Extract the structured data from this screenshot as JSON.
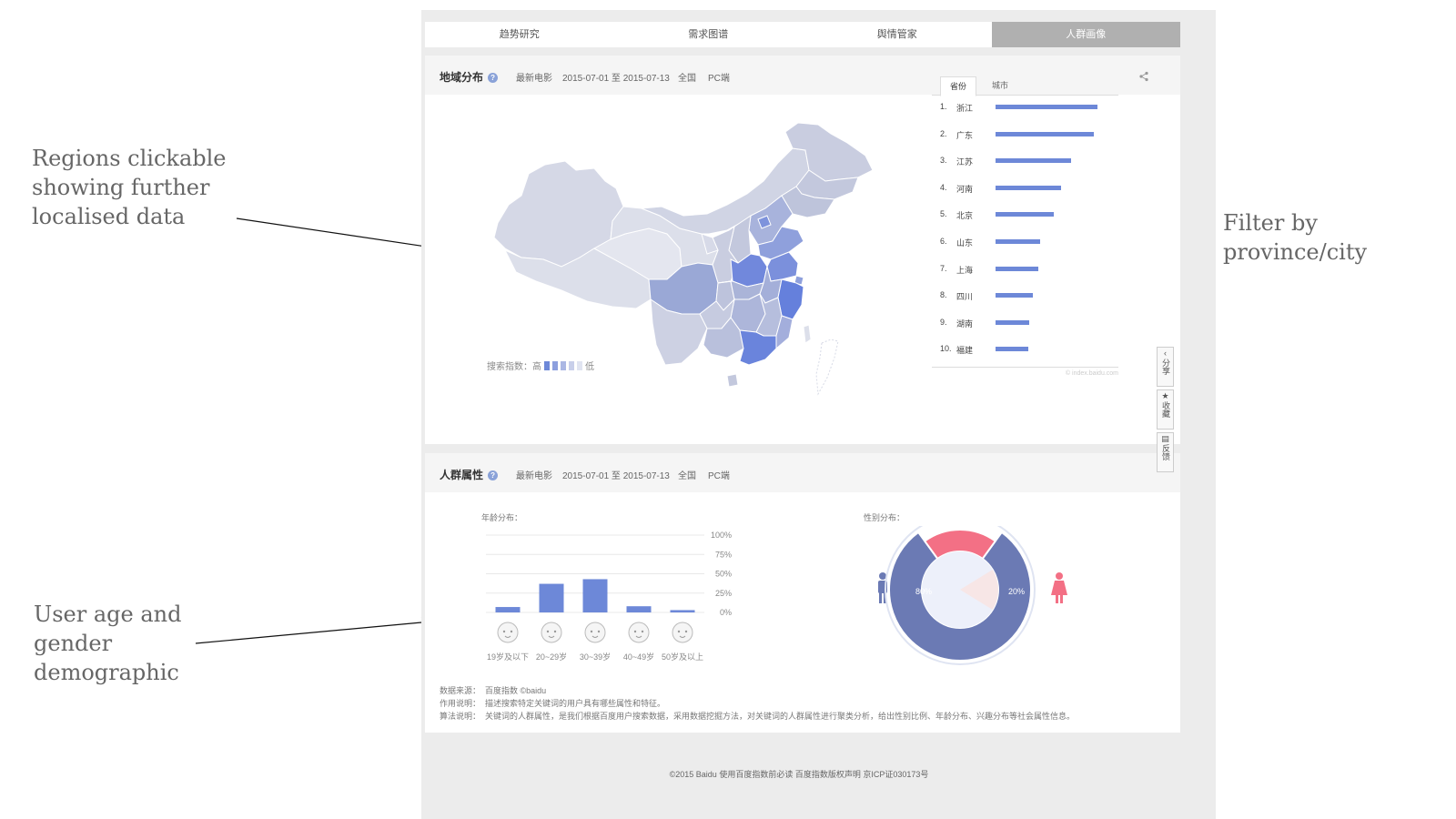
{
  "tabs": [
    {
      "label": "趋势研究",
      "active": false
    },
    {
      "label": "需求图谱",
      "active": false
    },
    {
      "label": "舆情管家",
      "active": false
    },
    {
      "label": "人群画像",
      "active": true
    }
  ],
  "region": {
    "title": "地域分布",
    "keyword": "最新电影",
    "date_range": "2015-07-01 至 2015-07-13",
    "area": "全国",
    "device": "PC端",
    "legend_label": "搜索指数：高",
    "legend_low": "低",
    "rank_tabs": [
      "省份",
      "城市"
    ],
    "rank_items": [
      {
        "rank": "1.",
        "name": "浙江",
        "value": 100
      },
      {
        "rank": "2.",
        "name": "广东",
        "value": 96
      },
      {
        "rank": "3.",
        "name": "江苏",
        "value": 74
      },
      {
        "rank": "4.",
        "name": "河南",
        "value": 64
      },
      {
        "rank": "5.",
        "name": "北京",
        "value": 57
      },
      {
        "rank": "6.",
        "name": "山东",
        "value": 44
      },
      {
        "rank": "7.",
        "name": "上海",
        "value": 42
      },
      {
        "rank": "8.",
        "name": "四川",
        "value": 37
      },
      {
        "rank": "9.",
        "name": "湖南",
        "value": 33
      },
      {
        "rank": "10.",
        "name": "福建",
        "value": 32
      }
    ],
    "watermark": "© index.baidu.com"
  },
  "crowd": {
    "title": "人群属性",
    "keyword": "最新电影",
    "date_range": "2015-07-01 至 2015-07-13",
    "area": "全国",
    "device": "PC端",
    "age_label": "年龄分布：",
    "gender_label": "性别分布：",
    "male_pct": "80%",
    "female_pct": "20%"
  },
  "chart_data": {
    "type": "bar",
    "categories": [
      "19岁及以下",
      "20~29岁",
      "30~39岁",
      "40~49岁",
      "50岁及以上"
    ],
    "values": [
      7,
      37,
      43,
      8,
      3
    ],
    "y_ticks": [
      "100%",
      "75%",
      "50%",
      "25%",
      "0%"
    ],
    "ylim": [
      0,
      100
    ],
    "grid": true
  },
  "gender_chart": {
    "type": "pie",
    "labels": [
      "男",
      "女"
    ],
    "values": [
      80,
      20
    ],
    "colors": [
      "#6b7ab4",
      "#f37085"
    ]
  },
  "footnotes": {
    "source_label": "数据来源：",
    "source_value": "百度指数 ©baidu",
    "purpose_label": "作用说明：",
    "purpose_value": "描述搜索特定关键词的用户具有哪些属性和特征。",
    "method_label": "算法说明：",
    "method_value": "关键词的人群属性，是我们根据百度用户搜索数据，采用数据挖掘方法，对关键词的人群属性进行聚类分析，给出性别比例、年龄分布、兴趣分布等社会属性信息。"
  },
  "side_buttons": [
    "分享",
    "收藏",
    "反馈"
  ],
  "copyright": "©2015 Baidu  使用百度指数前必读  百度指数版权声明  京ICP证030173号",
  "annotations": [
    "Regions clickable showing further localised data",
    "Filter by province/city",
    "User age and gender demographic"
  ],
  "colors": {
    "accent": "#6d88d8",
    "map_high": "#6d88d8",
    "map_low": "#e3e6ef",
    "male": "#6b7ab4",
    "female": "#f37085"
  }
}
